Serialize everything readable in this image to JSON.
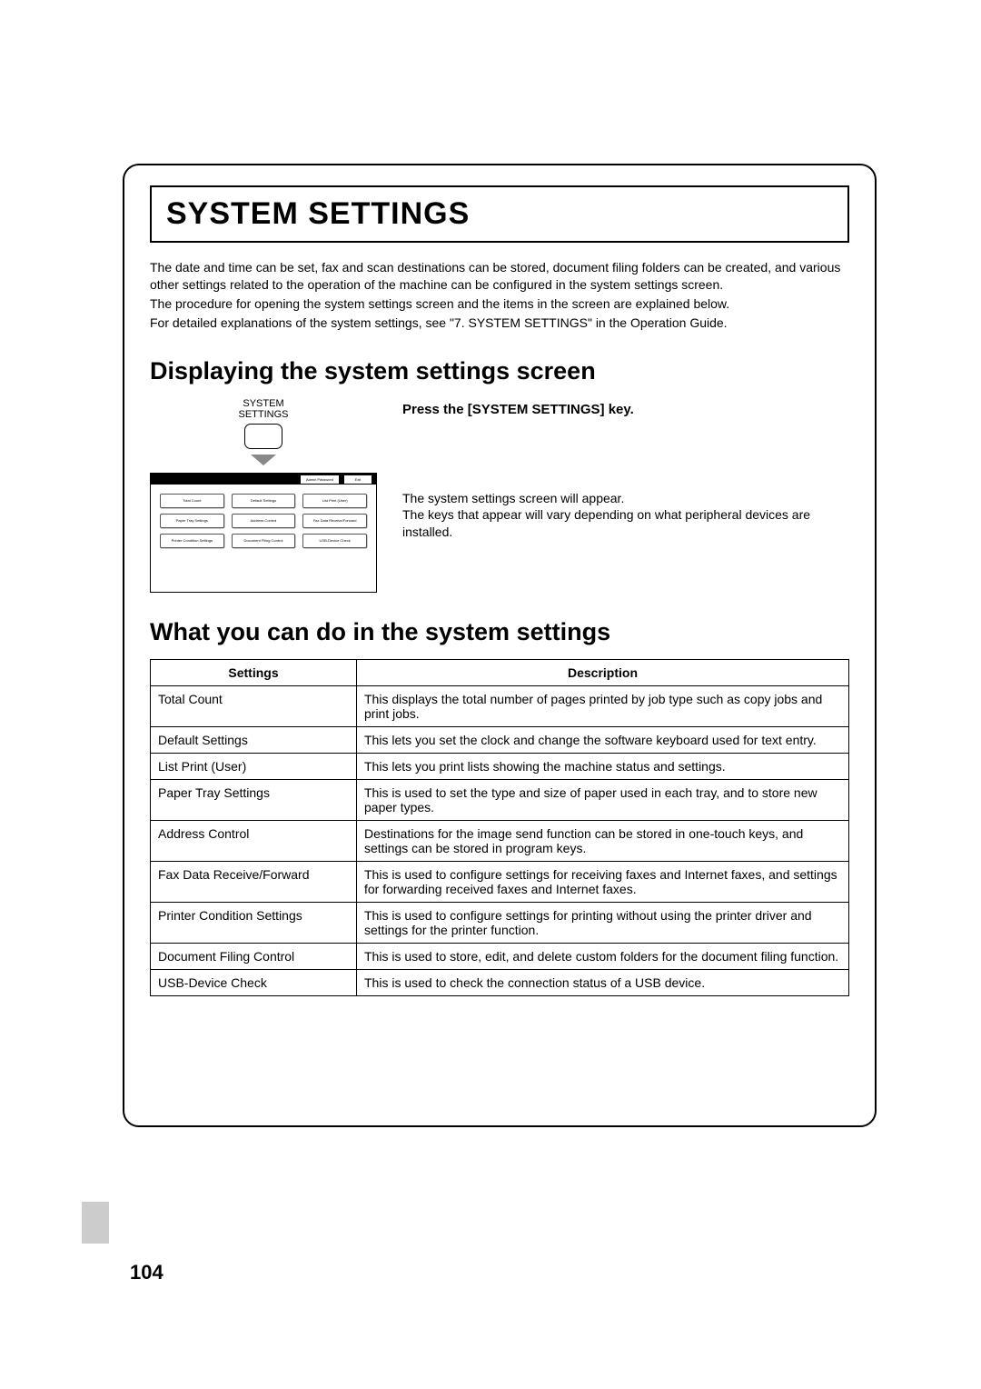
{
  "title": "SYSTEM SETTINGS",
  "intro": {
    "p1": "The date and time can be set, fax and scan destinations can be stored, document filing folders can be created, and various other settings related to the operation of the machine can be configured in the system settings screen.",
    "p2": "The procedure for opening the system settings screen and the items in the screen are explained below.",
    "p3": "For detailed explanations of the system settings, see \"7. SYSTEM SETTINGS\" in the Operation Guide."
  },
  "section1": {
    "heading": "Displaying the system settings screen",
    "key_label_line1": "SYSTEM",
    "key_label_line2": "SETTINGS",
    "instruction": "Press the [SYSTEM SETTINGS] key.",
    "body1": "The system settings screen will appear.",
    "body2": "The keys that appear will vary depending on what peripheral devices are installed.",
    "panel_titlebar": {
      "admin": "Admin Password",
      "exit": "Exit"
    },
    "panel_buttons": [
      "Total Count",
      "Default Settings",
      "List Print (User)",
      "Paper Tray Settings",
      "Address Control",
      "Fax Data Receive/Forward",
      "Printer Condition Settings",
      "Document Filing Control",
      "USB-Device Check"
    ]
  },
  "section2": {
    "heading": "What you can do in the system settings",
    "col1": "Settings",
    "col2": "Description",
    "rows": [
      {
        "s": "Total Count",
        "d": "This displays the total number of pages printed by job type such as copy jobs and print jobs."
      },
      {
        "s": "Default Settings",
        "d": "This lets you set the clock and change the software keyboard used for text entry."
      },
      {
        "s": "List Print (User)",
        "d": "This lets you print lists showing the machine status and settings."
      },
      {
        "s": "Paper Tray Settings",
        "d": "This is used to set the type and size of paper used in each tray, and to store new paper types."
      },
      {
        "s": "Address Control",
        "d": "Destinations for the image send function can be stored in one-touch keys, and settings can be stored in program keys."
      },
      {
        "s": "Fax Data Receive/Forward",
        "d": "This is used to configure settings for receiving faxes and Internet faxes, and settings for forwarding received faxes and Internet faxes."
      },
      {
        "s": "Printer Condition Settings",
        "d": "This is used to configure settings for printing without using the printer driver and settings for the printer function."
      },
      {
        "s": "Document Filing Control",
        "d": "This is used to store, edit, and delete custom folders for the document filing function."
      },
      {
        "s": "USB-Device Check",
        "d": "This is used to check the connection status of a USB device."
      }
    ]
  },
  "page_number": "104"
}
